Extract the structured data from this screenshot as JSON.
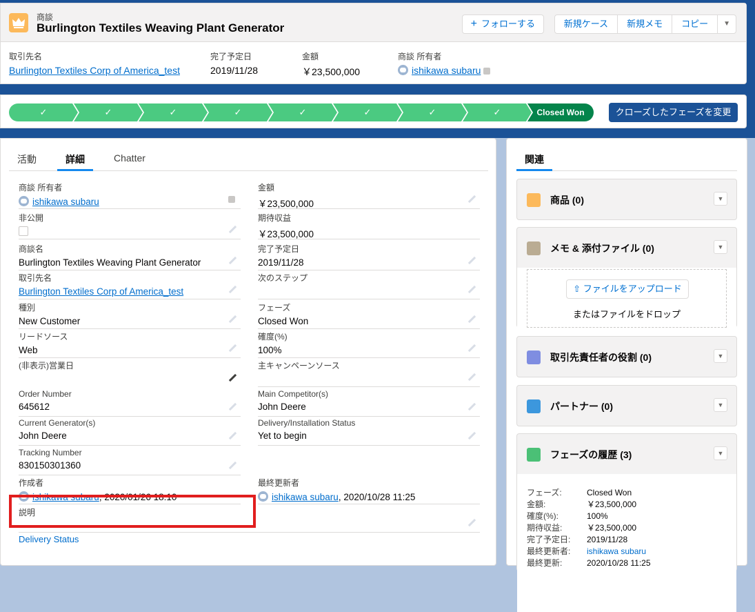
{
  "header": {
    "object_type": "商談",
    "title": "Burlington Textiles Weaving Plant Generator",
    "follow_label": "フォローする",
    "buttons": [
      "新規ケース",
      "新規メモ",
      "コピー"
    ],
    "highlights": [
      {
        "label": "取引先名",
        "value": "Burlington Textiles Corp of America_test"
      },
      {
        "label": "完了予定日",
        "value": "2019/11/28"
      },
      {
        "label": "金額",
        "value": "￥23,500,000"
      },
      {
        "label": "商談 所有者",
        "value": "ishikawa subaru"
      }
    ]
  },
  "path": {
    "final_stage": "Closed Won",
    "change_button": "クローズしたフェーズを変更"
  },
  "tabs": [
    "活動",
    "詳細",
    "Chatter"
  ],
  "details": {
    "owner_label": "商談 所有者",
    "owner_value": "ishikawa subaru",
    "amount_label": "金額",
    "amount_value": "￥23,500,000",
    "private_label": "非公開",
    "expected_revenue_label": "期待収益",
    "expected_revenue_value": "￥23,500,000",
    "name_label": "商談名",
    "name_value": "Burlington Textiles Weaving Plant Generator",
    "close_date_label": "完了予定日",
    "close_date_value": "2019/11/28",
    "account_label": "取引先名",
    "account_value": "Burlington Textiles Corp of America_test",
    "next_step_label": "次のステップ",
    "next_step_value": "",
    "type_label": "種別",
    "type_value": "New Customer",
    "stage_label": "フェーズ",
    "stage_value": "Closed Won",
    "lead_source_label": "リードソース",
    "lead_source_value": "Web",
    "probability_label": "確度(%)",
    "probability_value": "100%",
    "hidden_bizday_label": "(非表示)営業日",
    "hidden_bizday_value": "",
    "campaign_label": "主キャンペーンソース",
    "campaign_value": "",
    "order_number_label": "Order Number",
    "order_number_value": "645612",
    "competitors_label": "Main Competitor(s)",
    "competitors_value": "John Deere",
    "generators_label": "Current Generator(s)",
    "generators_value": "John Deere",
    "delivery_label": "Delivery/Installation Status",
    "delivery_value": "Yet to begin",
    "tracking_label": "Tracking Number",
    "tracking_value": "830150301360",
    "created_by_label": "作成者",
    "created_by_user": "ishikawa subaru",
    "created_by_date": ", 2020/01/26 18:10",
    "modified_by_label": "最終更新者",
    "modified_by_user": "ishikawa subaru",
    "modified_by_date": ", 2020/10/28 11:25",
    "description_label": "説明",
    "description_value": "",
    "delivery_status_link": "Delivery Status"
  },
  "related": {
    "tab": "関連",
    "products": "商品 (0)",
    "notes": "メモ & 添付ファイル (0)",
    "upload_button": "ファイルをアップロード",
    "drop_text": "またはファイルをドロップ",
    "contact_roles": "取引先責任者の役割 (0)",
    "partners": "パートナー (0)",
    "stage_history": "フェーズの履歴 (3)",
    "history": [
      {
        "k": "フェーズ:",
        "v": "Closed Won"
      },
      {
        "k": "金額:",
        "v": "￥23,500,000"
      },
      {
        "k": "確度(%):",
        "v": "100%"
      },
      {
        "k": "期待収益:",
        "v": "￥23,500,000"
      },
      {
        "k": "完了予定日:",
        "v": "2019/11/28"
      },
      {
        "k": "最終更新者:",
        "v": "ishikawa subaru"
      },
      {
        "k": "最終更新:",
        "v": "2020/10/28 11:25"
      }
    ]
  },
  "colors": {
    "path_complete": "#4bca81",
    "path_final": "#04844b",
    "brand": "#1b5297",
    "highlight_box": "#e11e1e"
  }
}
